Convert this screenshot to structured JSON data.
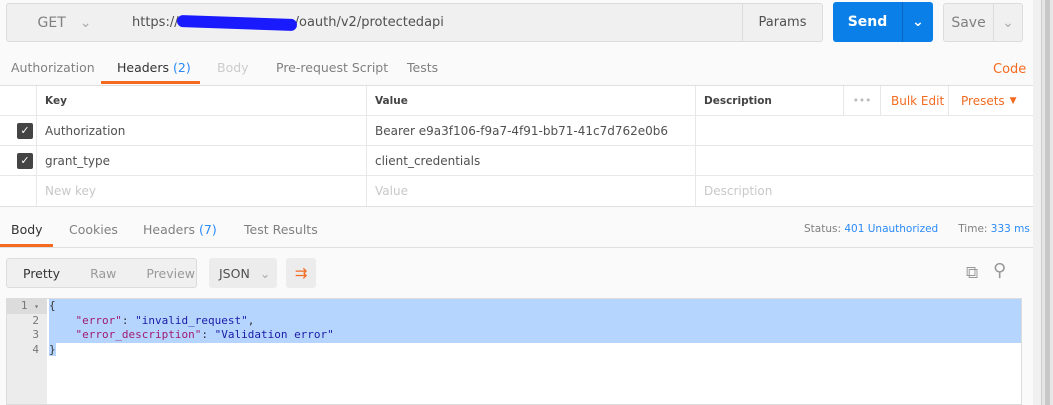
{
  "request": {
    "method": "GET",
    "url_prefix": "https://",
    "url_suffix": "/oauth/v2/protectedapi",
    "params_label": "Params",
    "send_label": "Send",
    "save_label": "Save"
  },
  "request_tabs": [
    {
      "label": "Authorization"
    },
    {
      "label": "Headers",
      "count": "(2)"
    },
    {
      "label": "Body"
    },
    {
      "label": "Pre-request Script"
    },
    {
      "label": "Tests"
    }
  ],
  "code_link": "Code",
  "headers_table": {
    "columns": [
      "Key",
      "Value",
      "Description"
    ],
    "bulk_edit": "Bulk Edit",
    "presets": "Presets",
    "rows": [
      {
        "key": "Authorization",
        "value": "Bearer e9a3f106-f9a7-4f91-bb71-41c7d762e0b6",
        "checked": true
      },
      {
        "key": "grant_type",
        "value": "client_credentials",
        "checked": true
      }
    ],
    "placeholders": {
      "key": "New key",
      "value": "Value",
      "description": "Description"
    }
  },
  "response_tabs": [
    {
      "label": "Body"
    },
    {
      "label": "Cookies"
    },
    {
      "label": "Headers",
      "count": "(7)"
    },
    {
      "label": "Test Results"
    }
  ],
  "status": {
    "label": "Status:",
    "value": "401 Unauthorized",
    "time_label": "Time:",
    "time_value": "333 ms"
  },
  "view": {
    "modes": [
      "Pretty",
      "Raw",
      "Preview"
    ],
    "format": "JSON"
  },
  "body_lines": [
    {
      "n": "1",
      "text": "{"
    },
    {
      "n": "2",
      "key": "\"error\"",
      "val": "\"invalid_request\"",
      "tail": ","
    },
    {
      "n": "3",
      "key": "\"error_description\"",
      "val": "\"Validation error\"",
      "tail": ""
    },
    {
      "n": "4",
      "text": "}"
    }
  ]
}
